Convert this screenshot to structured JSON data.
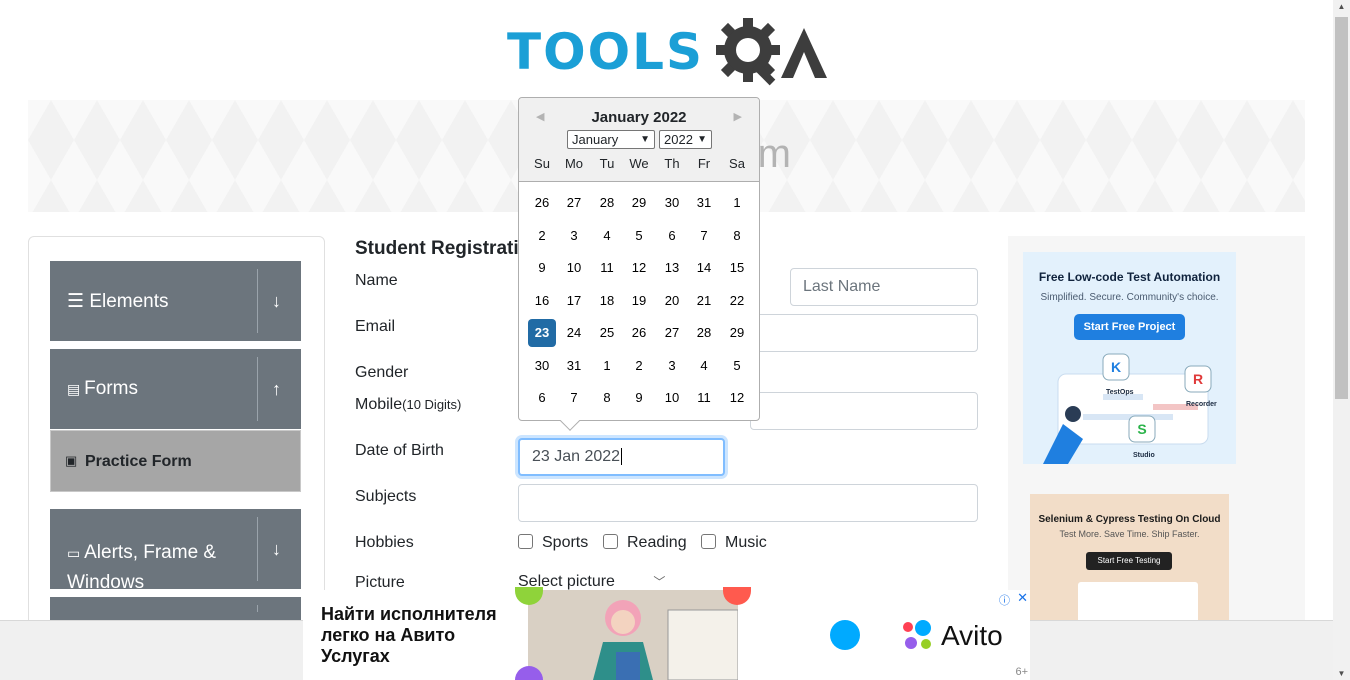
{
  "header": {
    "logo_text": "TOOLS",
    "logo_suffix": "A"
  },
  "banner": {
    "title": "Practice Form"
  },
  "nav": {
    "groups": [
      {
        "label": "Elements",
        "arrow": "↓"
      },
      {
        "label": "Forms",
        "arrow": "↑"
      },
      {
        "label": "Alerts, Frame & Windows",
        "arrow": "↓"
      }
    ],
    "active_item": "Practice Form"
  },
  "form": {
    "title": "Student Registration Form",
    "labels": {
      "name": "Name",
      "email": "Email",
      "gender": "Gender",
      "mobile": "Mobile",
      "mobile_hint": "(10 Digits)",
      "dob": "Date of Birth",
      "subjects": "Subjects",
      "hobbies": "Hobbies",
      "picture": "Picture"
    },
    "last_name_placeholder": "Last Name",
    "dob_value": "23 Jan 2022",
    "hobbies": [
      "Sports",
      "Reading",
      "Music"
    ],
    "picture_select": "Select picture"
  },
  "datepicker": {
    "month_title": "January 2022",
    "month_select": "January",
    "year_select": "2022",
    "day_names": [
      "Su",
      "Mo",
      "Tu",
      "We",
      "Th",
      "Fr",
      "Sa"
    ],
    "weeks": [
      [
        "26",
        "27",
        "28",
        "29",
        "30",
        "31",
        "1"
      ],
      [
        "2",
        "3",
        "4",
        "5",
        "6",
        "7",
        "8"
      ],
      [
        "9",
        "10",
        "11",
        "12",
        "13",
        "14",
        "15"
      ],
      [
        "16",
        "17",
        "18",
        "19",
        "20",
        "21",
        "22"
      ],
      [
        "23",
        "24",
        "25",
        "26",
        "27",
        "28",
        "29"
      ],
      [
        "30",
        "31",
        "1",
        "2",
        "3",
        "4",
        "5"
      ],
      [
        "6",
        "7",
        "8",
        "9",
        "10",
        "11",
        "12"
      ]
    ],
    "selected_day": "23"
  },
  "ads": {
    "ad1": {
      "title": "Free Low-code Test Automation",
      "subtitle": "Simplified. Secure. Community's choice.",
      "button": "Start Free Project",
      "labels": [
        "TestOps",
        "Recorder",
        "Studio"
      ]
    },
    "ad2": {
      "title": "Selenium & Cypress Testing On Cloud",
      "subtitle": "Test More. Save Time. Ship Faster.",
      "button": "Start Free Testing"
    },
    "bottom": {
      "text": "Найти исполнителя легко на Авито Услугах",
      "brand": "Avito",
      "info": "ⓘ",
      "close": "✕",
      "badge": "6+"
    }
  },
  "colors": {
    "accent": "#1b9fd6",
    "nav_bg": "#6c757d",
    "selected_day": "#216ba5"
  }
}
